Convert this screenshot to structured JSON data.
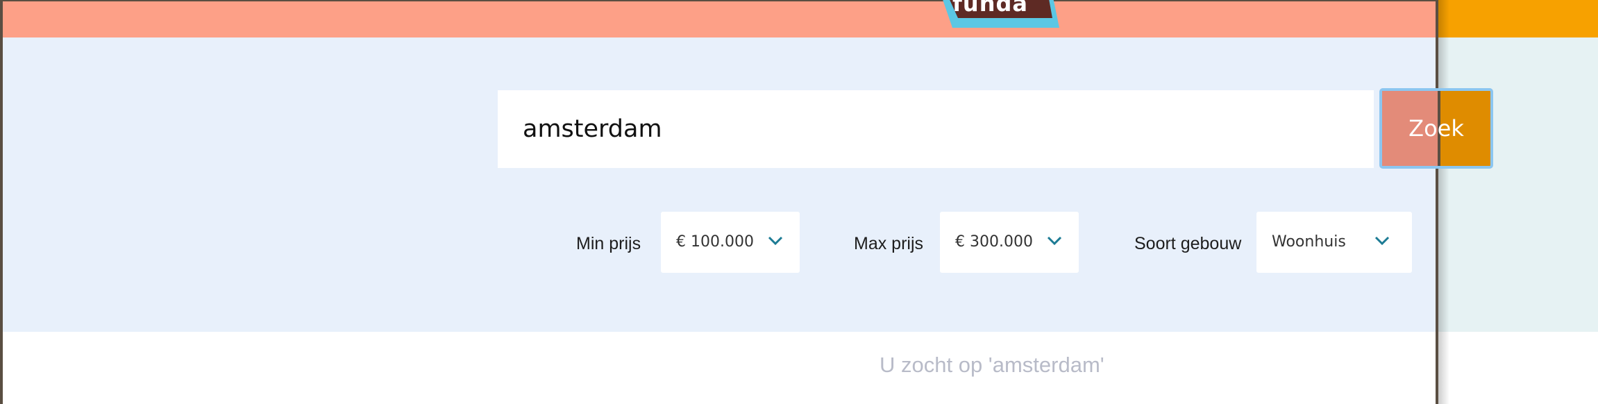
{
  "header": {
    "logo_text": "funda"
  },
  "search": {
    "value": "amsterdam",
    "button_label": "Zoek"
  },
  "filters": {
    "min_price": {
      "label": "Min prijs",
      "value": "€ 100.000"
    },
    "max_price": {
      "label": "Max prijs",
      "value": "€ 300.000"
    },
    "building_type": {
      "label": "Soort gebouw",
      "value": "Woonhuis"
    }
  },
  "results": {
    "message": "U zocht op 'amsterdam'"
  },
  "colors": {
    "header": "#fda087",
    "search_area": "#e8f0fb",
    "button": "#df8c00",
    "chevron": "#1c7b94",
    "logo_outline": "#5bc7e4",
    "logo_fill": "#5e2a24"
  },
  "icons": {
    "select_chevron": "chevron-down-icon"
  }
}
